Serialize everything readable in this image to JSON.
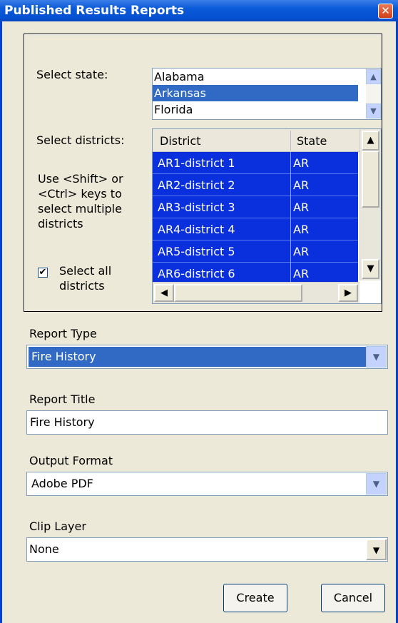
{
  "window": {
    "title": "Published Results Reports",
    "close_icon": "close-icon"
  },
  "labels": {
    "select_state": "Select state:",
    "select_districts": "Select districts:",
    "hint": "Use <Shift> or <Ctrl> keys to select multiple districts",
    "select_all": "Select all districts"
  },
  "select_all_checked": true,
  "states": [
    {
      "name": "Alabama",
      "selected": false
    },
    {
      "name": "Arkansas",
      "selected": true
    },
    {
      "name": "Florida",
      "selected": false
    }
  ],
  "districts": {
    "columns": [
      "District",
      "State"
    ],
    "rows": [
      [
        "AR1-district 1",
        "AR"
      ],
      [
        "AR2-district 2",
        "AR"
      ],
      [
        "AR3-district 3",
        "AR"
      ],
      [
        "AR4-district 4",
        "AR"
      ],
      [
        "AR5-district 5",
        "AR"
      ],
      [
        "AR6-district 6",
        "AR"
      ]
    ]
  },
  "report_type": {
    "label": "Report Type",
    "value": "Fire History"
  },
  "report_title": {
    "label": "Report Title",
    "value": "Fire History"
  },
  "output_format": {
    "label": "Output Format",
    "value": "Adobe PDF"
  },
  "clip_layer": {
    "label": "Clip Layer",
    "value": "None"
  },
  "buttons": {
    "create": "Create",
    "cancel": "Cancel"
  },
  "colors": {
    "titlebar": "#0a5ad9",
    "selection": "#316ac5",
    "grid_selection": "#0a2fdd",
    "background": "#ece9d8"
  }
}
